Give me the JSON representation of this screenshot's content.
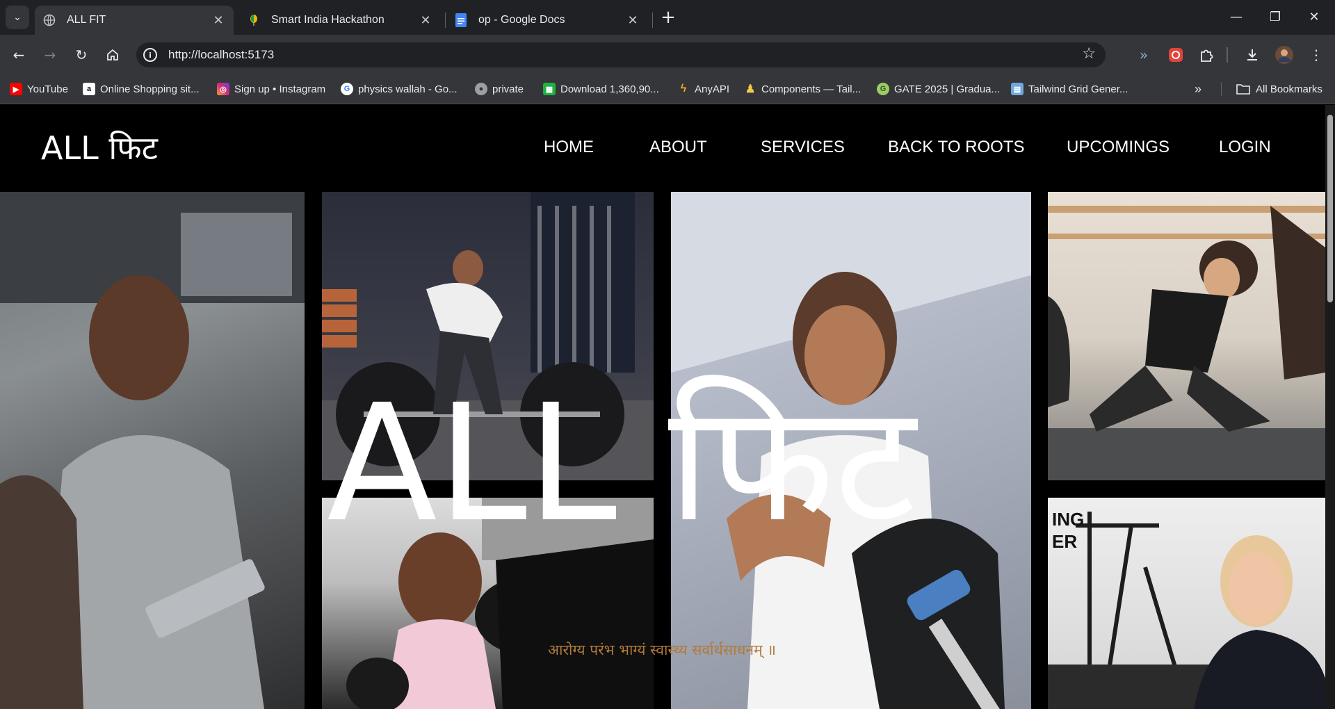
{
  "browser": {
    "tabs": [
      {
        "title": "ALL FIT",
        "active": true
      },
      {
        "title": "Smart India Hackathon",
        "active": false
      },
      {
        "title": "op - Google Docs",
        "active": false
      }
    ],
    "url": "http://localhost:5173",
    "bookmarks": [
      {
        "label": "YouTube",
        "icon": "youtube-icon"
      },
      {
        "label": "Online Shopping sit...",
        "icon": "amazon-icon"
      },
      {
        "label": "Sign up • Instagram",
        "icon": "instagram-icon"
      },
      {
        "label": "physics wallah - Go...",
        "icon": "google-icon"
      },
      {
        "label": "private",
        "icon": "private-icon"
      },
      {
        "label": "Download 1,360,90...",
        "icon": "download-site-icon"
      },
      {
        "label": "AnyAPI",
        "icon": "anyapi-icon"
      },
      {
        "label": "Components — Tail...",
        "icon": "tailwind-components-icon"
      },
      {
        "label": "GATE 2025 | Gradua...",
        "icon": "gate-icon"
      },
      {
        "label": "Tailwind Grid Gener...",
        "icon": "grid-generator-icon"
      }
    ],
    "all_bookmarks_label": "All Bookmarks"
  },
  "site": {
    "logo": "ALL फिट",
    "nav": [
      "HOME",
      "ABOUT",
      "SERVICES",
      "BACK TO ROOTS",
      "UPCOMINGS",
      "LOGIN"
    ],
    "hero_title": "ALL फिट",
    "hero_subtitle": "आरोग्य परंभ भाग्यं स्वास्थ्य सर्वार्थसाधनम् ॥"
  }
}
